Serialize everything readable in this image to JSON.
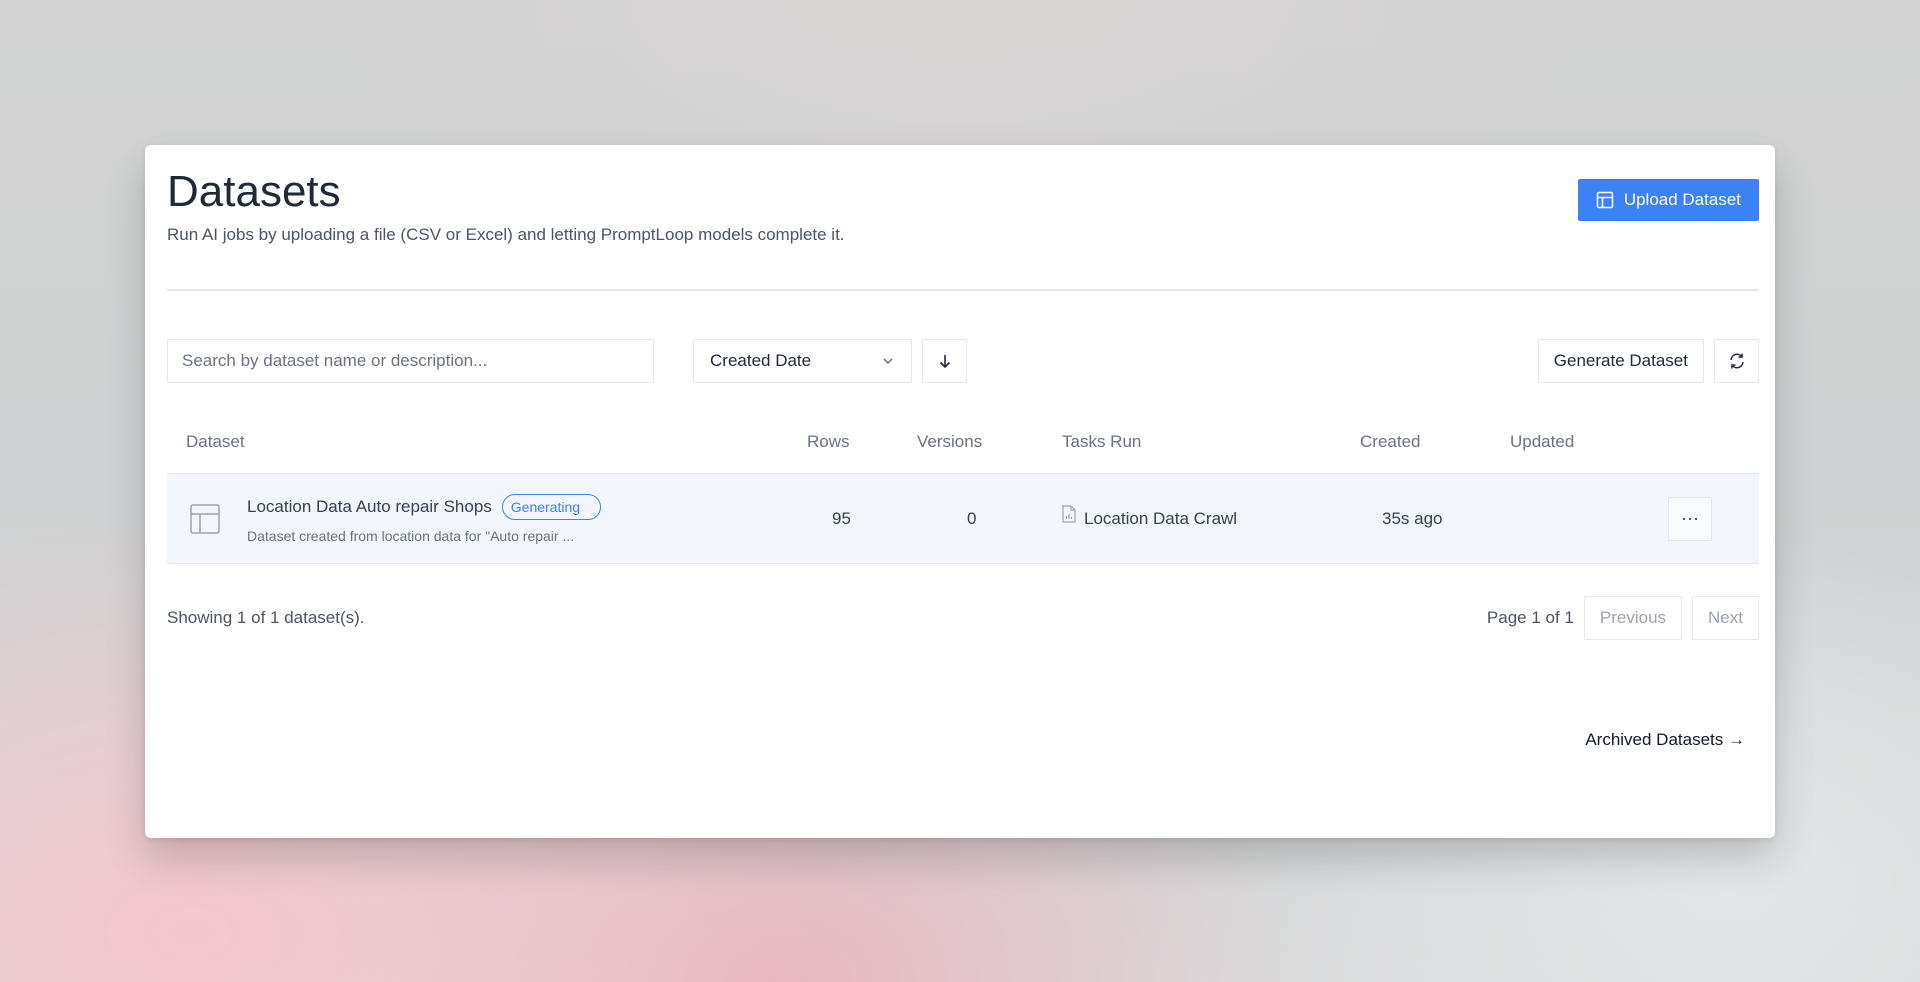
{
  "header": {
    "title": "Datasets",
    "subtitle": "Run AI jobs by uploading a file (CSV or Excel) and letting PromptLoop models complete it.",
    "upload_label": "Upload Dataset"
  },
  "toolbar": {
    "search_placeholder": "Search by dataset name or description...",
    "sort_selected": "Created Date",
    "generate_label": "Generate Dataset"
  },
  "table": {
    "columns": [
      "Dataset",
      "Rows",
      "Versions",
      "Tasks Run",
      "Created",
      "Updated"
    ],
    "rows": [
      {
        "name": "Location Data Auto repair Shops",
        "status": "Generating",
        "description": "Dataset created from location data for \"Auto repair ...",
        "rows": "95",
        "versions": "0",
        "tasks_run": "Location Data Crawl",
        "created": "35s ago",
        "updated": ""
      }
    ]
  },
  "footer": {
    "showing": "Showing 1 of 1 dataset(s).",
    "page_text": "Page 1 of 1",
    "previous_label": "Previous",
    "next_label": "Next",
    "archived_label": "Archived Datasets →"
  },
  "colors": {
    "accent": "#3b82f6",
    "row_highlight": "#f3f7fd"
  }
}
